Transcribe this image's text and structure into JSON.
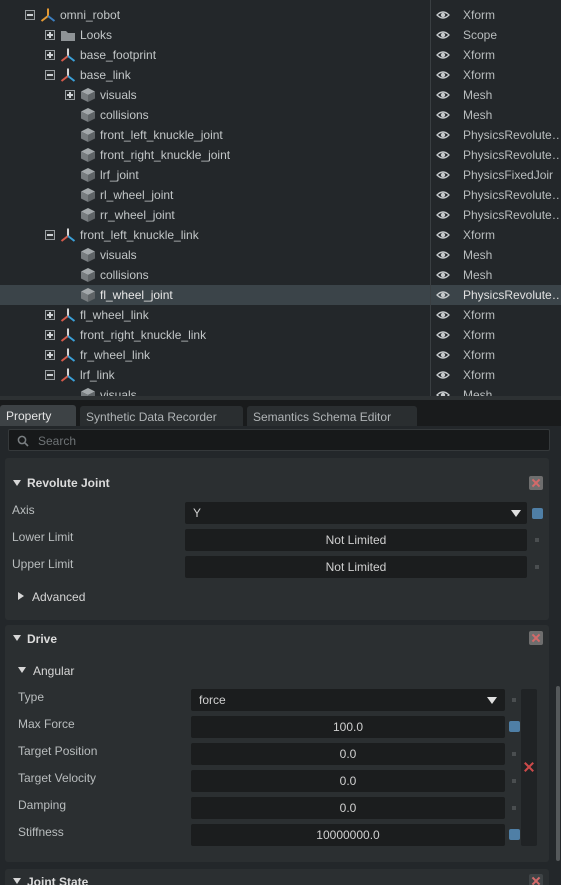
{
  "stage": {
    "rows": [
      {
        "name": "omni_robot",
        "type": "Xform",
        "icon": "xform-orange-icon",
        "expander": "minus"
      },
      {
        "name": "Looks",
        "type": "Scope",
        "icon": "folder-icon",
        "expander": "plus"
      },
      {
        "name": "base_footprint",
        "type": "Xform",
        "icon": "xform-icon",
        "expander": "plus"
      },
      {
        "name": "base_link",
        "type": "Xform",
        "icon": "xform-icon",
        "expander": "minus"
      },
      {
        "name": "visuals",
        "type": "Mesh",
        "icon": "mesh-cube-icon",
        "expander": "plus"
      },
      {
        "name": "collisions",
        "type": "Mesh",
        "icon": "mesh-cube-icon",
        "expander": "none"
      },
      {
        "name": "front_left_knuckle_joint",
        "type": "PhysicsRevolute…",
        "icon": "mesh-cube-icon",
        "expander": "none"
      },
      {
        "name": "front_right_knuckle_joint",
        "type": "PhysicsRevolute…",
        "icon": "mesh-cube-icon",
        "expander": "none"
      },
      {
        "name": "lrf_joint",
        "type": "PhysicsFixedJoir",
        "icon": "mesh-cube-icon",
        "expander": "none"
      },
      {
        "name": "rl_wheel_joint",
        "type": "PhysicsRevolute…",
        "icon": "mesh-cube-icon",
        "expander": "none"
      },
      {
        "name": "rr_wheel_joint",
        "type": "PhysicsRevolute…",
        "icon": "mesh-cube-icon",
        "expander": "none"
      },
      {
        "name": "front_left_knuckle_link",
        "type": "Xform",
        "icon": "xform-icon",
        "expander": "minus"
      },
      {
        "name": "visuals",
        "type": "Mesh",
        "icon": "mesh-cube-icon",
        "expander": "none"
      },
      {
        "name": "collisions",
        "type": "Mesh",
        "icon": "mesh-cube-icon",
        "expander": "none"
      },
      {
        "name": "fl_wheel_joint",
        "type": "PhysicsRevolute…",
        "icon": "mesh-cube-icon",
        "expander": "none",
        "selected": true
      },
      {
        "name": "fl_wheel_link",
        "type": "Xform",
        "icon": "xform-icon",
        "expander": "plus"
      },
      {
        "name": "front_right_knuckle_link",
        "type": "Xform",
        "icon": "xform-icon",
        "expander": "plus"
      },
      {
        "name": "fr_wheel_link",
        "type": "Xform",
        "icon": "xform-icon",
        "expander": "plus"
      },
      {
        "name": "lrf_link",
        "type": "Xform",
        "icon": "xform-icon",
        "expander": "minus"
      },
      {
        "name": "visuals",
        "type": "Mesh",
        "icon": "mesh-cube-icon",
        "expander": "none"
      }
    ]
  },
  "tabs": [
    {
      "label": "Property",
      "active": true
    },
    {
      "label": "Synthetic Data Recorder",
      "active": false
    },
    {
      "label": "Semantics Schema Editor",
      "active": false
    }
  ],
  "search": {
    "placeholder": "Search"
  },
  "revolute_joint": {
    "title": "Revolute Joint",
    "axis_label": "Axis",
    "axis_value": "Y",
    "lower_limit_label": "Lower Limit",
    "lower_limit_value": "Not Limited",
    "upper_limit_label": "Upper Limit",
    "upper_limit_value": "Not Limited",
    "advanced_label": "Advanced"
  },
  "drive": {
    "title": "Drive",
    "angular_label": "Angular",
    "fields": {
      "type_label": "Type",
      "type_value": "force",
      "max_force_label": "Max Force",
      "max_force_value": "100.0",
      "target_position_label": "Target Position",
      "target_position_value": "0.0",
      "target_velocity_label": "Target Velocity",
      "target_velocity_value": "0.0",
      "damping_label": "Damping",
      "damping_value": "0.0",
      "stiffness_label": "Stiffness",
      "stiffness_value": "10000000.0"
    }
  },
  "joint_state": {
    "title": "Joint State"
  },
  "colors": {
    "accent": "#4f7fa6",
    "selected_row": "#3b4449",
    "remove": "#cc4a4a"
  }
}
